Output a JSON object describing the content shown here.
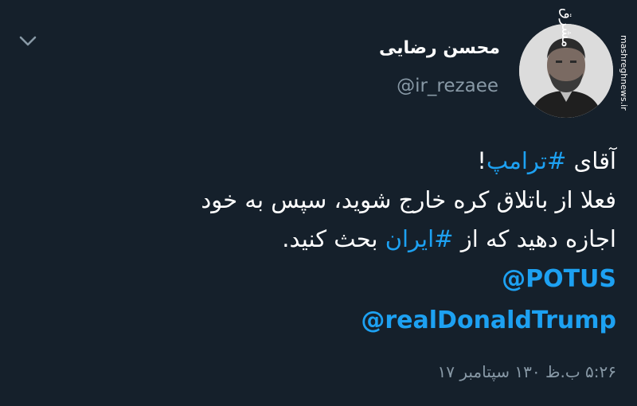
{
  "watermark": {
    "brand": "مشرق",
    "site": "mashreghnews.ir"
  },
  "author": {
    "name": "محسن رضایی",
    "handle": "@ir_rezaee"
  },
  "tweet": {
    "line1_prefix": "آقای ",
    "line1_hashtag": "#ترامپ",
    "line1_suffix": "!",
    "line2": "فعلا از باتلاق کره خارج شوید، سپس به خود",
    "line3_prefix": "اجازه دهید که از ",
    "line3_hashtag": "#ایران",
    "line3_suffix": " بحث کنید.",
    "mention1": "@POTUS",
    "mention2": "@realDonaldTrump"
  },
  "timestamp": "۵:۲۶ ب.ظ ۱۳۰ سپتامبر ۱۷",
  "icons": {
    "menu": "chevron-down-icon"
  },
  "colors": {
    "background": "#15202b",
    "link": "#1da1f2",
    "secondary_text": "#8899a6"
  }
}
